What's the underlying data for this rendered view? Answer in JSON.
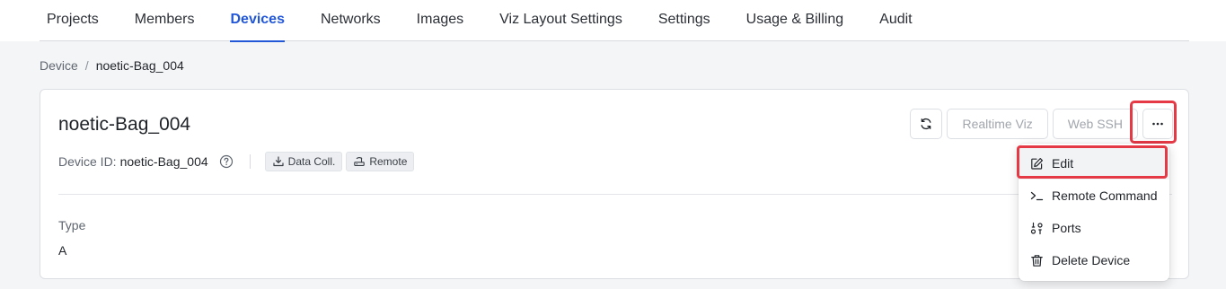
{
  "tabs": [
    {
      "label": "Projects"
    },
    {
      "label": "Members"
    },
    {
      "label": "Devices",
      "active": true
    },
    {
      "label": "Networks"
    },
    {
      "label": "Images"
    },
    {
      "label": "Viz Layout Settings"
    },
    {
      "label": "Settings"
    },
    {
      "label": "Usage & Billing"
    },
    {
      "label": "Audit"
    }
  ],
  "breadcrumb": {
    "parent": "Device",
    "separator": "/",
    "current": "noetic-Bag_004"
  },
  "device": {
    "title": "noetic-Bag_004",
    "id_label": "Device ID:",
    "id_value": "noetic-Bag_004",
    "tags": [
      {
        "label": "Data Coll.",
        "icon": "download-tray-icon"
      },
      {
        "label": "Remote",
        "icon": "router-icon"
      }
    ],
    "type_label": "Type",
    "type_value": "A"
  },
  "actions": {
    "refresh_icon": "refresh-icon",
    "realtime_viz": "Realtime Viz",
    "web_ssh": "Web SSH",
    "more_icon": "more-horizontal-icon"
  },
  "menu": {
    "items": [
      {
        "label": "Edit",
        "icon": "edit-icon"
      },
      {
        "label": "Remote Command",
        "icon": "terminal-icon"
      },
      {
        "label": "Ports",
        "icon": "ports-icon"
      },
      {
        "label": "Delete Device",
        "icon": "trash-icon"
      }
    ]
  },
  "colors": {
    "accent": "#2257d8",
    "highlight": "#e63946",
    "background": "#f4f5f7"
  }
}
